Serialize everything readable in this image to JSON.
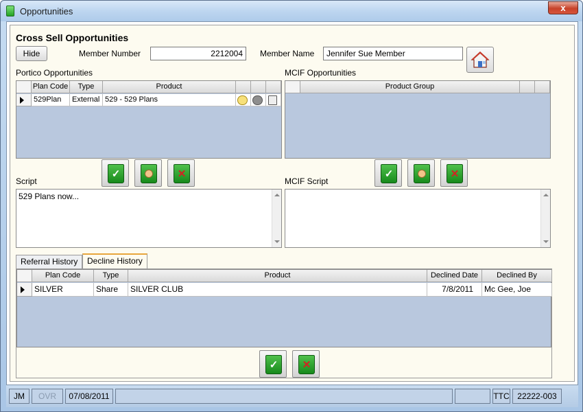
{
  "window": {
    "title": "Opportunities",
    "close_label": "x"
  },
  "header": {
    "section_title": "Cross Sell Opportunities",
    "hide_button": "Hide",
    "member_number_label": "Member Number",
    "member_number_value": "2212004",
    "member_name_label": "Member Name",
    "member_name_value": "Jennifer Sue Member"
  },
  "portico": {
    "label": "Portico Opportunities",
    "columns": [
      "Plan Code",
      "Type",
      "Product"
    ],
    "rows": [
      {
        "plan_code": "529Plan",
        "type": "External",
        "product": "529 - 529 Plans"
      }
    ]
  },
  "mcif": {
    "label": "MCIF Opportunities",
    "columns": [
      "Product Group"
    ]
  },
  "script": {
    "label": "Script",
    "text": "529 Plans now..."
  },
  "mcif_script": {
    "label": "MCIF Script",
    "text": ""
  },
  "tabs": [
    {
      "label": "Referral History",
      "active": false
    },
    {
      "label": "Decline History",
      "active": true
    }
  ],
  "decline_history": {
    "columns": [
      "Plan Code",
      "Type",
      "Product",
      "Declined Date",
      "Declined By"
    ],
    "rows": [
      {
        "plan_code": "SILVER",
        "type": "Share",
        "product": "SILVER CLUB",
        "declined_date": "7/8/2011",
        "declined_by": "Mc Gee, Joe"
      }
    ]
  },
  "statusbar": {
    "user": "JM",
    "ovr": "OVR",
    "date": "07/08/2011",
    "ttc": "TTC",
    "code": "22222-003"
  },
  "colors": {
    "grid_bg": "#b9c8de",
    "panel_bg": "#fdfbf0",
    "accent_tab": "#e8a53b"
  }
}
